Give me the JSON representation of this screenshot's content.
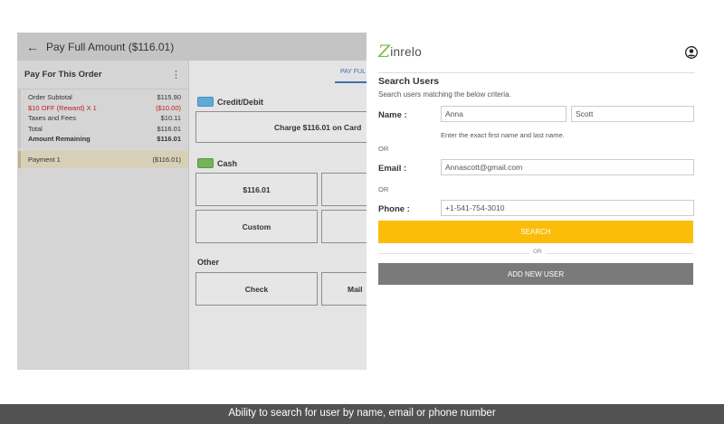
{
  "header": {
    "title": "Pay Full Amount ($116.01)",
    "back_icon": "←"
  },
  "order": {
    "title": "Pay For This Order",
    "menu_icon": "⋮",
    "rows": [
      {
        "label": "Order Subtotal",
        "value": "$115.90"
      },
      {
        "label": "$10 OFF (Reward) X 1",
        "value": "($10.00)"
      },
      {
        "label": "Taxes and Fees",
        "value": "$10.11"
      },
      {
        "label": "Total",
        "value": "$116.01"
      },
      {
        "label": "Amount Remaining",
        "value": "$116.01"
      }
    ],
    "payment": {
      "label": "Payment 1",
      "value": "($116.01)"
    }
  },
  "payment_panel": {
    "tab_label": "PAY FUL",
    "card_section": "Credit/Debit",
    "charge_button": "Charge $116.01 on Card",
    "cash_section": "Cash",
    "cash_exact": "$116.01",
    "custom": "Custom",
    "other_section": "Other",
    "check": "Check",
    "mail": "Mail"
  },
  "search": {
    "logo_z": "Z",
    "logo_rest": "inrelo",
    "title": "Search Users",
    "subtitle": "Search users matching the below criteria.",
    "name_label": "Name :",
    "first_name": "Anna",
    "last_name": "Scott",
    "hint": "Enter the exact first name and last name.",
    "or": "OR",
    "email_label": "Email :",
    "email": "Annascott@gmail.com",
    "phone_label": "Phone :",
    "phone": "+1-541-754-3010",
    "search_button": "SEARCH",
    "add_button": "ADD NEW USER"
  },
  "caption": "Ability to search for user by name, email or phone number",
  "colors": {
    "accent": "#fbbd0a",
    "logo_green": "#79b93f",
    "tab_blue": "#3a72b0",
    "reward_red": "#c02020"
  }
}
